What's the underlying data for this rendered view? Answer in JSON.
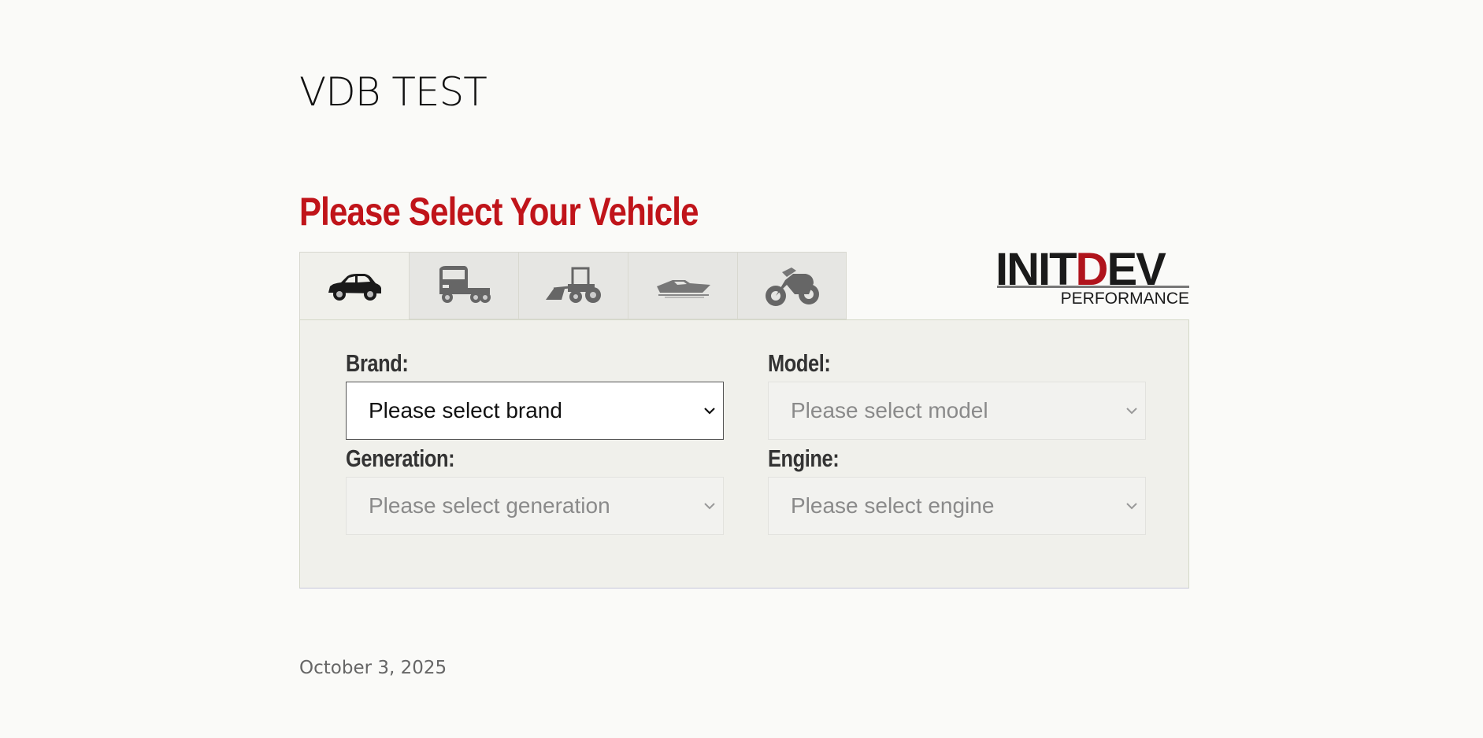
{
  "page": {
    "title": "VDB TEST",
    "date": "October 3, 2025"
  },
  "selector": {
    "heading": "Please Select Your Vehicle",
    "tabs": [
      {
        "icon": "car-icon",
        "active": true
      },
      {
        "icon": "truck-icon",
        "active": false
      },
      {
        "icon": "tractor-icon",
        "active": false
      },
      {
        "icon": "boat-icon",
        "active": false
      },
      {
        "icon": "motorcycle-icon",
        "active": false
      }
    ],
    "logo": {
      "main_left": "INIT",
      "main_accent": "D",
      "main_right": "EV",
      "sub": "PERFORMANCE"
    },
    "fields": {
      "brand": {
        "label": "Brand:",
        "placeholder": "Please select brand",
        "enabled": true
      },
      "model": {
        "label": "Model:",
        "placeholder": "Please select model",
        "enabled": false
      },
      "generation": {
        "label": "Generation:",
        "placeholder": "Please select generation",
        "enabled": false
      },
      "engine": {
        "label": "Engine:",
        "placeholder": "Please select engine",
        "enabled": false
      }
    }
  },
  "colors": {
    "accent_red": "#c0141a",
    "logo_red": "#b0141c"
  }
}
